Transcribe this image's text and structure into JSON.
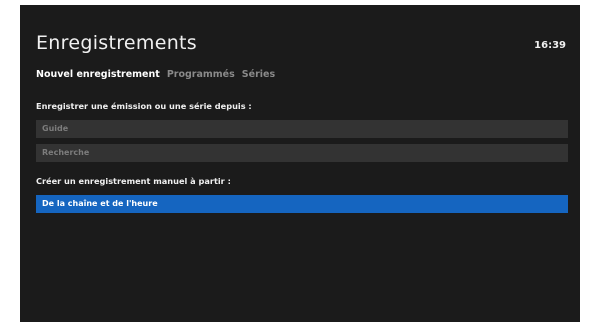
{
  "header": {
    "title": "Enregistrements",
    "clock": "16:39"
  },
  "tabs": [
    {
      "label": "Nouvel enregistrement",
      "active": true
    },
    {
      "label": "Programmés",
      "active": false
    },
    {
      "label": "Séries",
      "active": false
    }
  ],
  "section_from": {
    "heading": "Enregistrer une émission ou une série depuis :",
    "items": [
      {
        "label": "Guide"
      },
      {
        "label": "Recherche"
      }
    ]
  },
  "section_manual": {
    "heading": "Créer un enregistrement manuel à partir :",
    "items": [
      {
        "label": "De la chaîne et de l'heure",
        "selected": true
      }
    ]
  },
  "colors": {
    "background": "#1b1b1b",
    "row": "#333333",
    "selected": "#1565c0",
    "inactive_text": "#8a8a8a"
  }
}
